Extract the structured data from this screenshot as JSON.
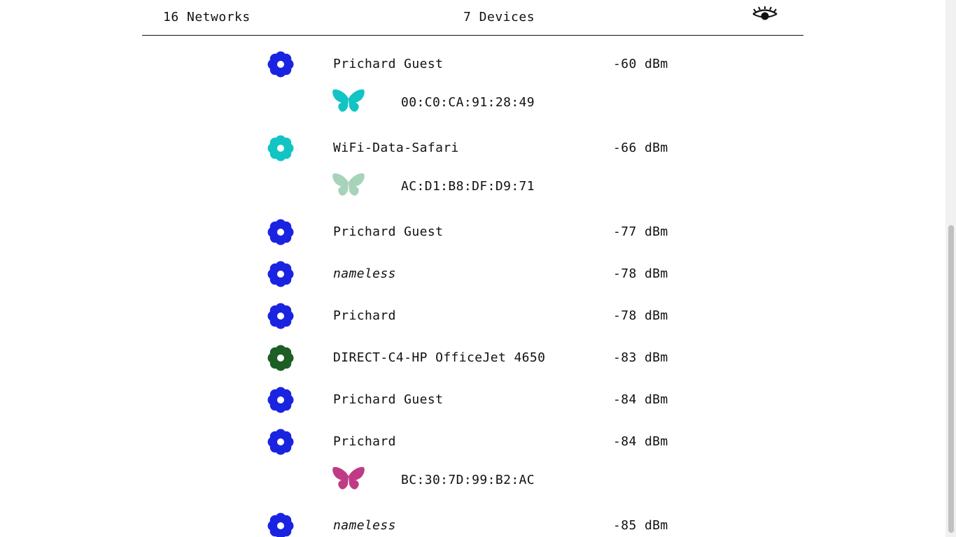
{
  "header": {
    "networks_label": "16 Networks",
    "devices_label": "7 Devices",
    "toggle_icon": "eye-icon"
  },
  "rows": [
    {
      "kind": "network",
      "name": "Prichard Guest",
      "signal": "-60 dBm",
      "color": "#1a24e0",
      "italic": false
    },
    {
      "kind": "device",
      "mac": "00:C0:CA:91:28:49",
      "color": "#12c4c4"
    },
    {
      "kind": "network",
      "name": "WiFi-Data-Safari",
      "signal": "-66 dBm",
      "color": "#12c4c4",
      "italic": false
    },
    {
      "kind": "device",
      "mac": "AC:D1:B8:DF:D9:71",
      "color": "#a7d3b9"
    },
    {
      "kind": "network",
      "name": "Prichard Guest",
      "signal": "-77 dBm",
      "color": "#1a24e0",
      "italic": false
    },
    {
      "kind": "network",
      "name": "nameless",
      "signal": "-78 dBm",
      "color": "#1a24e0",
      "italic": true
    },
    {
      "kind": "network",
      "name": "Prichard",
      "signal": "-78 dBm",
      "color": "#1a24e0",
      "italic": false
    },
    {
      "kind": "network",
      "name": "DIRECT-C4-HP OfficeJet 4650",
      "signal": "-83 dBm",
      "color": "#1d5e26",
      "italic": false
    },
    {
      "kind": "network",
      "name": "Prichard Guest",
      "signal": "-84 dBm",
      "color": "#1a24e0",
      "italic": false
    },
    {
      "kind": "network",
      "name": "Prichard",
      "signal": "-84 dBm",
      "color": "#1a24e0",
      "italic": false
    },
    {
      "kind": "device",
      "mac": "BC:30:7D:99:B2:AC",
      "color": "#c03a85"
    },
    {
      "kind": "network",
      "name": "nameless",
      "signal": "-85 dBm",
      "color": "#1a24e0",
      "italic": true
    }
  ]
}
